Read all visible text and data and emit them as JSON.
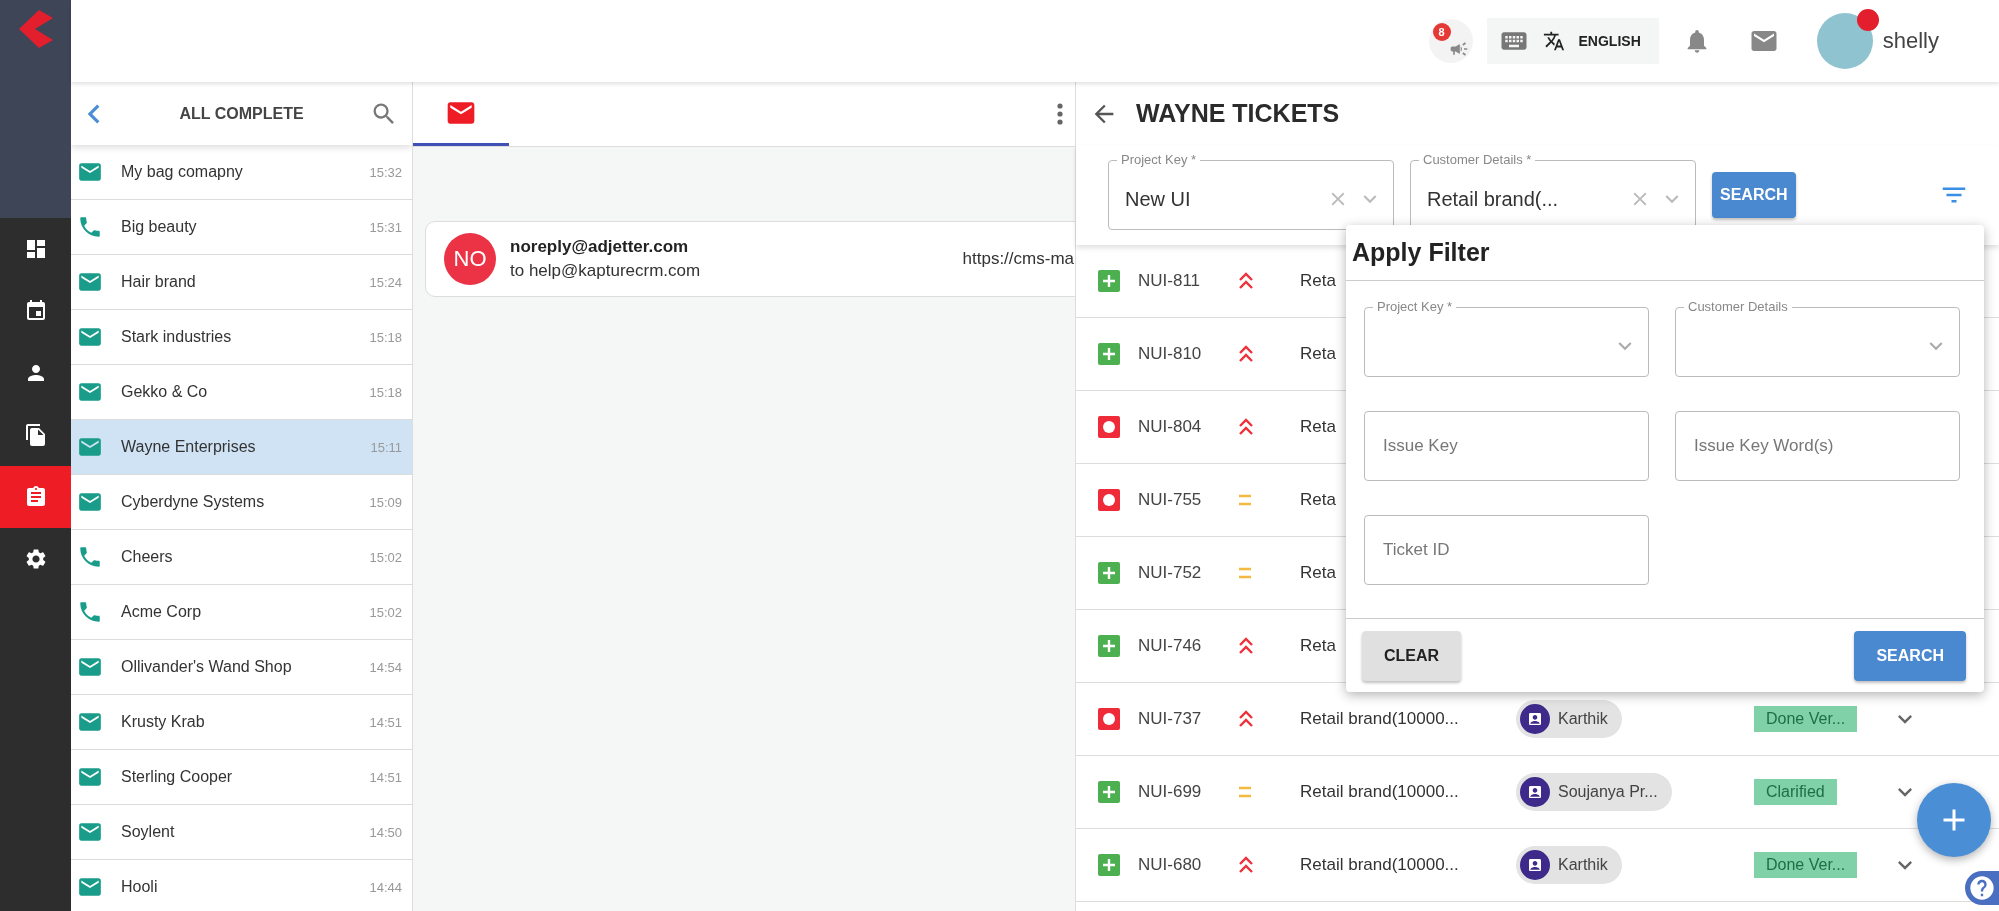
{
  "rail": {
    "items": [
      {
        "kind": "dashboard",
        "selected": false
      },
      {
        "kind": "calendar",
        "selected": false
      },
      {
        "kind": "contacts",
        "selected": false
      },
      {
        "kind": "documents",
        "selected": false
      },
      {
        "kind": "tickets",
        "selected": true
      },
      {
        "kind": "settings",
        "selected": false
      }
    ]
  },
  "topbar": {
    "announcements_badge": "8",
    "language": "ENGLISH",
    "user": "shelly"
  },
  "conversations": {
    "title": "ALL COMPLETE",
    "items": [
      {
        "kind": "email",
        "name": "My bag comapny",
        "time": "15:32",
        "selected": false
      },
      {
        "kind": "call",
        "name": "Big beauty",
        "time": "15:31",
        "selected": false
      },
      {
        "kind": "email",
        "name": "Hair brand",
        "time": "15:24",
        "selected": false
      },
      {
        "kind": "email",
        "name": "Stark industries",
        "time": "15:18",
        "selected": false
      },
      {
        "kind": "email",
        "name": "Gekko & Co",
        "time": "15:18",
        "selected": false
      },
      {
        "kind": "email",
        "name": "Wayne Enterprises",
        "time": "15:11",
        "selected": true
      },
      {
        "kind": "email",
        "name": "Cyberdyne Systems",
        "time": "15:09",
        "selected": false
      },
      {
        "kind": "call",
        "name": "Cheers",
        "time": "15:02",
        "selected": false
      },
      {
        "kind": "call",
        "name": "Acme Corp",
        "time": "15:02",
        "selected": false
      },
      {
        "kind": "email",
        "name": "Ollivander's Wand Shop",
        "time": "14:54",
        "selected": false
      },
      {
        "kind": "email",
        "name": "Krusty Krab",
        "time": "14:51",
        "selected": false
      },
      {
        "kind": "email",
        "name": "Sterling Cooper",
        "time": "14:51",
        "selected": false
      },
      {
        "kind": "email",
        "name": "Soylent",
        "time": "14:50",
        "selected": false
      },
      {
        "kind": "email",
        "name": "Hooli",
        "time": "14:44",
        "selected": false
      }
    ]
  },
  "inbox": {
    "tabs": [
      {
        "kind": "email",
        "selected": true
      }
    ],
    "messages": [
      {
        "initials": "NO",
        "from": "noreply@adjetter.com",
        "to": "to help@kapturecrm.com",
        "preview": "https://cms-ma"
      }
    ]
  },
  "tickets": {
    "title": "WAYNE TICKETS",
    "filters": [
      {
        "label": "Project Key *",
        "value": "New UI"
      },
      {
        "label": "Customer Details *",
        "value": "Retail brand(..."
      }
    ],
    "search_button": "SEARCH",
    "rows": [
      {
        "kind": "story",
        "id": "NUI-811",
        "priority": {
          "kind": "highest"
        },
        "summary": "Reta"
      },
      {
        "kind": "story",
        "id": "NUI-810",
        "priority": {
          "kind": "highest"
        },
        "summary": "Reta"
      },
      {
        "kind": "bug",
        "id": "NUI-804",
        "priority": {
          "kind": "highest"
        },
        "summary": "Reta"
      },
      {
        "kind": "bug",
        "id": "NUI-755",
        "priority": {
          "kind": "medium"
        },
        "summary": "Reta"
      },
      {
        "kind": "story",
        "id": "NUI-752",
        "priority": {
          "kind": "medium"
        },
        "summary": "Reta"
      },
      {
        "kind": "story",
        "id": "NUI-746",
        "priority": {
          "kind": "highest"
        },
        "summary": "Reta"
      },
      {
        "kind": "bug",
        "id": "NUI-737",
        "priority": {
          "kind": "highest"
        },
        "summary": "Retail brand(10000...",
        "assignee": "Karthik",
        "status": "Done Ver..."
      },
      {
        "kind": "story",
        "id": "NUI-699",
        "priority": {
          "kind": "medium"
        },
        "summary": "Retail brand(10000...",
        "assignee": "Soujanya Pr...",
        "status": "Clarified"
      },
      {
        "kind": "story",
        "id": "NUI-680",
        "priority": {
          "kind": "highest"
        },
        "summary": "Retail brand(10000...",
        "assignee": "Karthik",
        "status": "Done Ver..."
      }
    ]
  },
  "filter_dialog": {
    "title": "Apply Filter",
    "fields": [
      {
        "kind": "select",
        "label": "Project Key *"
      },
      {
        "kind": "select",
        "label": "Customer Details"
      },
      {
        "kind": "text",
        "placeholder": "Issue Key"
      },
      {
        "kind": "text",
        "placeholder": "Issue Key Word(s)"
      },
      {
        "kind": "text",
        "placeholder": "Ticket ID"
      }
    ],
    "buttons": [
      {
        "kind": "secondary",
        "label": "CLEAR"
      },
      {
        "kind": "primary",
        "label": "SEARCH"
      }
    ]
  }
}
